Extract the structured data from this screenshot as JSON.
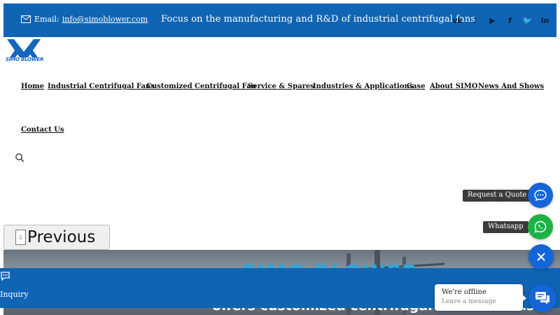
{
  "topbar": {
    "email_label": "Email:",
    "email": "info@simoblower.com",
    "slogan": "Focus on the manufacturing and R&D of industrial centrifugal fans",
    "social": [
      {
        "icon": "vk-icon",
        "glyph": "vk"
      },
      {
        "icon": "tiktok-icon",
        "glyph": "♪"
      },
      {
        "icon": "youtube-icon",
        "glyph": "▶"
      },
      {
        "icon": "facebook-icon",
        "glyph": "f"
      },
      {
        "icon": "twitter-icon",
        "glyph": "🐦"
      },
      {
        "icon": "linkedin-icon",
        "glyph": "in"
      }
    ],
    "bg_color": "#0f64b4"
  },
  "logo": {
    "text": "SIMO BLOWER",
    "color": "#1565c0"
  },
  "nav": {
    "items": [
      {
        "label": "Home"
      },
      {
        "label": "Industrial Centrifugal Fans"
      },
      {
        "label": "Customized Centrifugal Fan"
      },
      {
        "label": "Service & Spares"
      },
      {
        "label": "Industries & Applications"
      },
      {
        "label": "Case"
      },
      {
        "label": "About SIMO"
      },
      {
        "label": "News And Shows"
      },
      {
        "label": "Contact Us"
      }
    ]
  },
  "slider": {
    "previous_label": "Previous",
    "hero_title": "SIMO BLOWER",
    "hero_subtitle": "offers customized centrifugal fan solutions"
  },
  "inquiry": {
    "label": "Inquiry"
  },
  "floating": {
    "quote_label": "Request a Quote",
    "whatsapp_label": "Whatsapp"
  },
  "chat": {
    "title": "We're offline",
    "subtitle": "Leave a message"
  }
}
